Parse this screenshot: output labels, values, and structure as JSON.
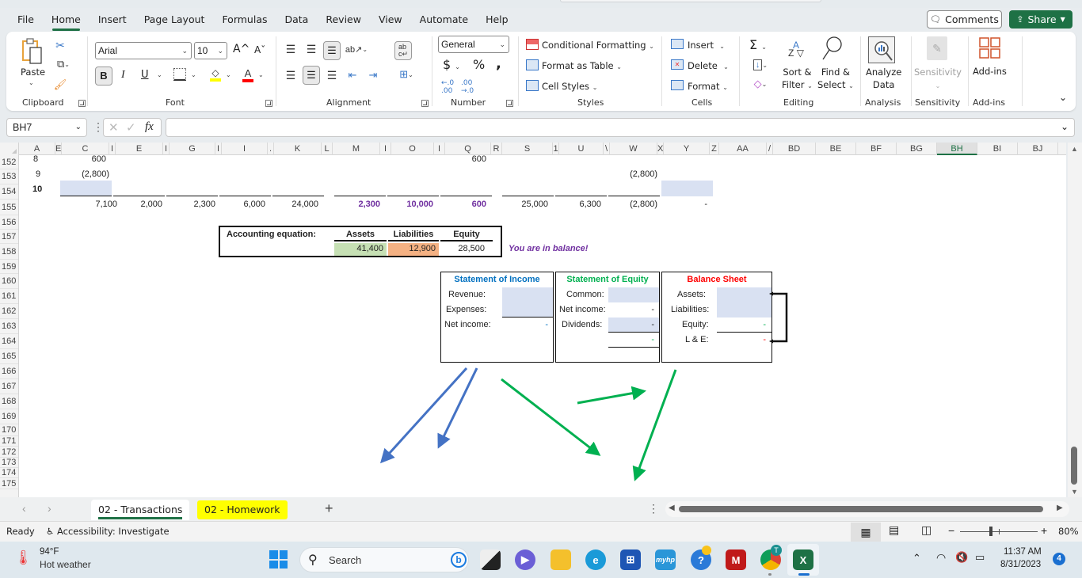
{
  "window": {
    "menu_tabs": [
      "File",
      "Home",
      "Insert",
      "Page Layout",
      "Formulas",
      "Data",
      "Review",
      "View",
      "Automate",
      "Help"
    ],
    "active_tab": "Home",
    "comments_label": "Comments",
    "share_label": "Share"
  },
  "ribbon": {
    "clipboard": {
      "paste_label": "Paste",
      "group_label": "Clipboard"
    },
    "font": {
      "font_name": "Arial",
      "font_size": "10",
      "group_label": "Font",
      "bold": "B",
      "italic": "I",
      "underline": "U",
      "grow": "A^",
      "shrink": "Aˇ",
      "font_color_letter": "A",
      "fill_color": "#ffff00",
      "text_color": "#ff0000"
    },
    "alignment": {
      "group_label": "Alignment"
    },
    "number": {
      "format": "General",
      "group_label": "Number",
      "currency": "$",
      "percent": "%",
      "comma": "❜"
    },
    "styles": {
      "conditional_formatting": "Conditional Formatting",
      "format_as_table": "Format as Table",
      "cell_styles": "Cell Styles",
      "group_label": "Styles"
    },
    "cells": {
      "insert": "Insert",
      "delete": "Delete",
      "format": "Format",
      "group_label": "Cells"
    },
    "editing": {
      "sort_filter_1": "Sort &",
      "sort_filter_2": "Filter",
      "find_select_1": "Find &",
      "find_select_2": "Select",
      "group_label": "Editing"
    },
    "analysis": {
      "analyze_1": "Analyze",
      "analyze_2": "Data",
      "group_label": "Analysis"
    },
    "sensitivity": {
      "label": "Sensitivity",
      "group_label": "Sensitivity"
    },
    "addins": {
      "label": "Add-ins",
      "group_label": "Add-ins"
    }
  },
  "formula_bar": {
    "name_box": "BH7",
    "formula": "",
    "fx": "fx"
  },
  "columns": [
    "A",
    "E",
    "C",
    "I",
    "E",
    "I",
    "G",
    "I",
    "I",
    ".",
    "K",
    "L",
    "M",
    "I",
    "O",
    "I",
    "Q",
    "R",
    "S",
    "1",
    "U",
    "\\",
    "W",
    "X",
    "Y",
    "Z",
    "AA",
    "/",
    "BD",
    "BE",
    "BF",
    "BG",
    "BH",
    "BI",
    "BJ"
  ],
  "selected_column": "BH",
  "rows": [
    "152",
    "153",
    "154",
    "155",
    "156",
    "157",
    "158",
    "159",
    "160",
    "161",
    "162",
    "163",
    "164",
    "165",
    "166",
    "167",
    "168",
    "169",
    "170",
    "171",
    "172",
    "173",
    "174",
    "175"
  ],
  "cells": {
    "r152": {
      "a": "8",
      "c": "600",
      "q": "600"
    },
    "r153": {
      "a": "9",
      "c": "(2,800)",
      "w": "(2,800)"
    },
    "r154": {
      "a": "10"
    },
    "r155": {
      "c": "7,100",
      "e": "2,000",
      "g": "2,300",
      "i": "6,000",
      "k": "24,000",
      "m": "2,300",
      "o": "10,000",
      "q": "600",
      "s": "25,000",
      "u": "6,300",
      "w": "(2,800)",
      "y": "-"
    }
  },
  "accounting_equation": {
    "label": "Accounting equation:",
    "headers": [
      "Assets",
      "Liabilities",
      "Equity"
    ],
    "values": [
      "41,400",
      "12,900",
      "28,500"
    ],
    "asset_color": "#c6e0b4",
    "liability_color": "#f4b183",
    "status": "You are in balance!"
  },
  "statement_income": {
    "title": "Statement of Income",
    "title_color": "#0070c0",
    "rows": [
      {
        "label": "Revenue:",
        "value": ""
      },
      {
        "label": "Expenses:",
        "value": ""
      },
      {
        "label": "Net income:",
        "value": "-"
      }
    ]
  },
  "statement_equity": {
    "title": "Statement of Equity",
    "title_color": "#00b050",
    "rows": [
      {
        "label": "Common:",
        "value": ""
      },
      {
        "label": "Net income:",
        "value": "-"
      },
      {
        "label": "Dividends:",
        "value": "-"
      },
      {
        "label": "",
        "value": "-"
      }
    ]
  },
  "balance_sheet": {
    "title": "Balance Sheet",
    "title_color": "#ff0000",
    "rows": [
      {
        "label": "Assets:",
        "value": ""
      },
      {
        "label": "Liabilities:",
        "value": ""
      },
      {
        "label": "Equity:",
        "value": "-"
      },
      {
        "label": "L & E:",
        "value": "-"
      }
    ]
  },
  "sheets": {
    "tabs": [
      "02 - Transactions",
      "02 - Homework"
    ],
    "active": "02 - Transactions",
    "homework_color": "#ffff00"
  },
  "status_bar": {
    "ready": "Ready",
    "accessibility": "Accessibility: Investigate",
    "zoom": "80%",
    "zoom_fraction": 0.4
  },
  "taskbar": {
    "weather_temp": "94°F",
    "weather_desc": "Hot weather",
    "search_placeholder": "Search",
    "time": "11:37 AM",
    "date": "8/31/2023",
    "notification_count": "4",
    "chrome_badge": "T"
  }
}
